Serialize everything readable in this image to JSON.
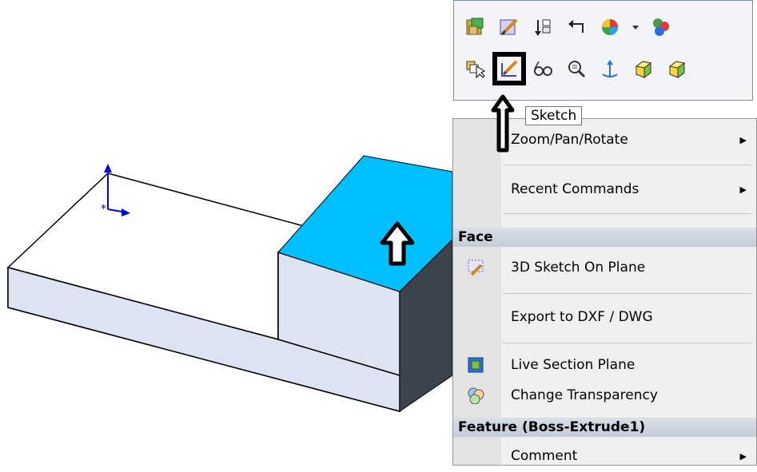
{
  "toolbar": {
    "row1": [
      {
        "icon": "materials-icon"
      },
      {
        "icon": "edit-icon"
      },
      {
        "icon": "rollback-icon"
      },
      {
        "icon": "undo-icon"
      },
      {
        "icon": "appearance-icon"
      },
      {
        "icon": "dropdown-icon"
      },
      {
        "icon": "color-balls-icon"
      }
    ],
    "row2": [
      {
        "icon": "select-other-icon"
      },
      {
        "icon": "sketch-icon",
        "selected": true
      },
      {
        "icon": "hide-show-icon"
      },
      {
        "icon": "zoom-to-selection-icon"
      },
      {
        "icon": "normal-to-icon"
      },
      {
        "icon": "box-icon"
      },
      {
        "icon": "box-icon"
      }
    ]
  },
  "tooltip": {
    "text": "Sketch"
  },
  "menu": {
    "items_top": [
      {
        "label": "Zoom/Pan/Rotate",
        "submenu": true
      },
      {
        "label": "Recent Commands",
        "submenu": true
      }
    ],
    "section_face": "Face",
    "face_items": [
      {
        "label": "3D Sketch On Plane",
        "icon": "sketch-3d-icon"
      },
      {
        "label": "Export to DXF / DWG",
        "icon": ""
      },
      {
        "label": "Live Section Plane",
        "icon": "section-plane-icon"
      },
      {
        "label": "Change Transparency",
        "icon": "transparency-icon"
      }
    ],
    "section_feature": "Feature (Boss-Extrude1)",
    "feature_items": [
      {
        "label": "Comment",
        "submenu": true
      }
    ]
  },
  "colors": {
    "selected_face": "#00bfff",
    "part_side": "#dde3f0",
    "part_dark": "#3d434d",
    "sketch_axis": "#0000ee"
  }
}
